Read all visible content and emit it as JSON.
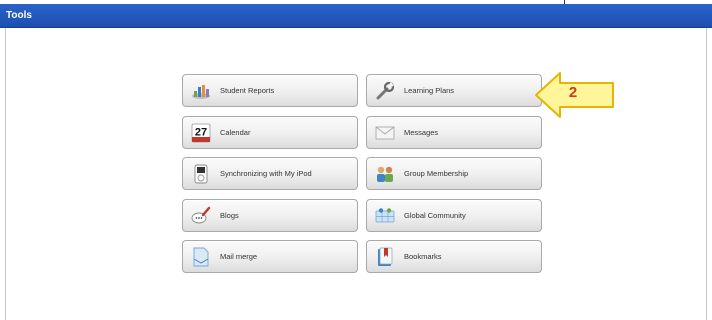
{
  "window": {
    "title": "Tools"
  },
  "tools": [
    {
      "label": "Student Reports",
      "icon": "chart-icon"
    },
    {
      "label": "Learning Plans",
      "icon": "wrench-icon"
    },
    {
      "label": "Calendar",
      "icon": "calendar-icon",
      "day": "27"
    },
    {
      "label": "Messages",
      "icon": "envelope-icon"
    },
    {
      "label": "Synchronizing with My iPod",
      "icon": "ipod-icon"
    },
    {
      "label": "Group Membership",
      "icon": "group-icon"
    },
    {
      "label": "Blogs",
      "icon": "blog-icon"
    },
    {
      "label": "Global Community",
      "icon": "globe-grid-icon"
    },
    {
      "label": "Mail merge",
      "icon": "mail-merge-icon"
    },
    {
      "label": "Bookmarks",
      "icon": "bookmarks-icon"
    }
  ],
  "callout": {
    "number": "2",
    "fill_color": "#fff59a",
    "border_color": "#e8b400"
  },
  "colors": {
    "titlebar": "#2a63c9",
    "titlebar_text": "#ffffff"
  }
}
